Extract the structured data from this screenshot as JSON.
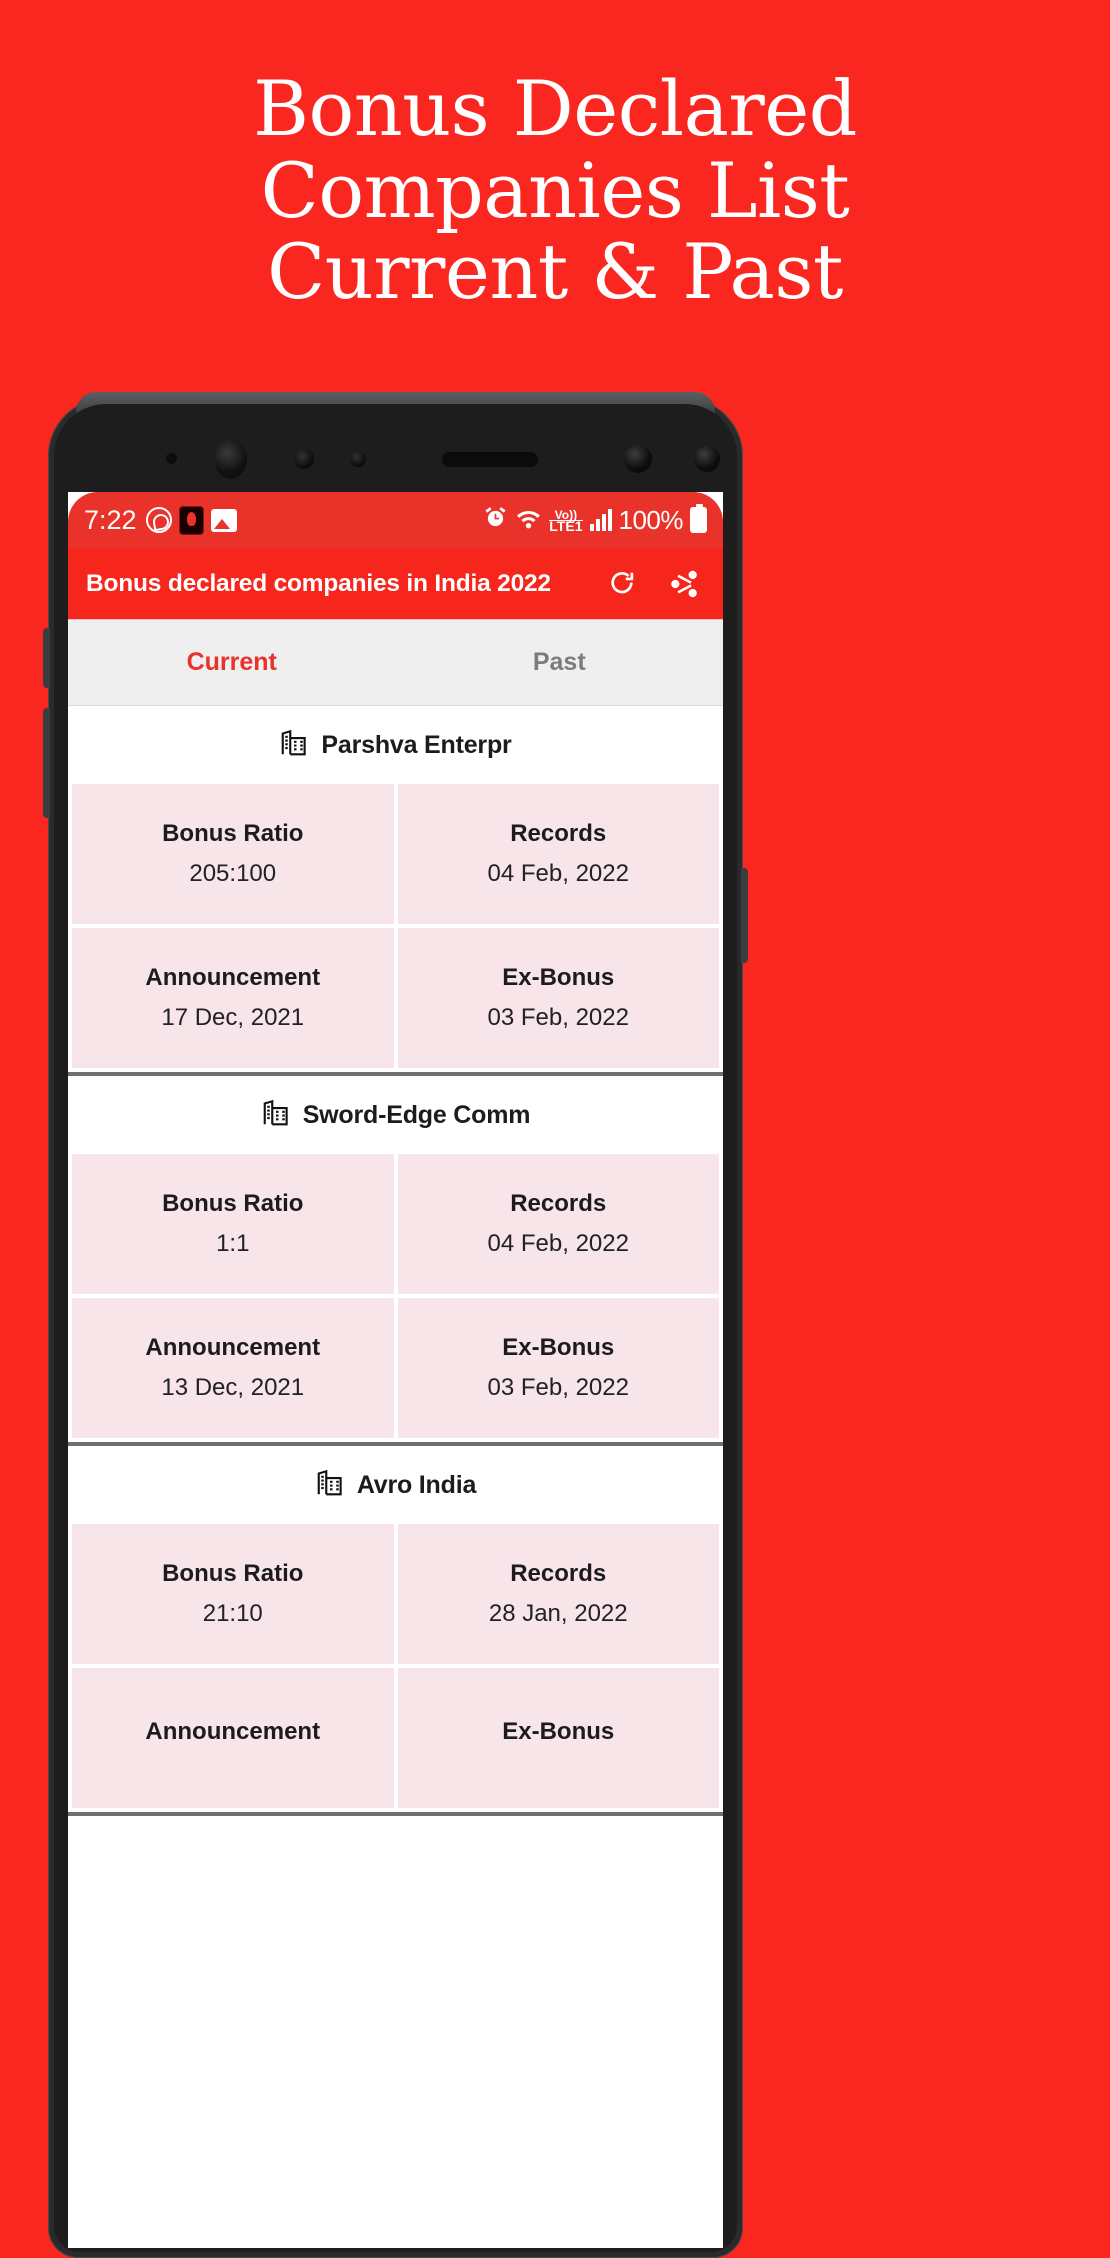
{
  "promo": {
    "headline_lines": [
      "Bonus Declared",
      "Companies List",
      "Current & Past"
    ],
    "background_color": "#fa2720",
    "text_color": "#ffffff"
  },
  "status_bar": {
    "time": "7:22",
    "battery_percent": "100%",
    "network_label_top": "Vo))",
    "network_label_bottom": "LTE1",
    "left_icons": [
      "whatsapp-icon",
      "app-icon",
      "gallery-icon"
    ],
    "right_icons": [
      "alarm-icon",
      "wifi-icon",
      "volte-icon",
      "signal-icon",
      "battery-icon"
    ]
  },
  "app_bar": {
    "title": "Bonus declared companies in India 2022",
    "refresh_label": "refresh-icon",
    "share_label": "share-icon",
    "background_color": "#f6261d"
  },
  "tabs": [
    {
      "label": "Current",
      "active": true
    },
    {
      "label": "Past",
      "active": false
    }
  ],
  "labels": {
    "bonus_ratio": "Bonus Ratio",
    "records": "Records",
    "announcement": "Announcement",
    "ex_bonus": "Ex-Bonus"
  },
  "companies": [
    {
      "name": "Parshva Enterpr",
      "bonus_ratio": "205:100",
      "records": "04 Feb, 2022",
      "announcement": "17 Dec, 2021",
      "ex_bonus": "03 Feb, 2022"
    },
    {
      "name": "Sword-Edge Comm",
      "bonus_ratio": "1:1",
      "records": "04 Feb, 2022",
      "announcement": "13 Dec, 2021",
      "ex_bonus": "03 Feb, 2022"
    },
    {
      "name": "Avro India",
      "bonus_ratio": "21:10",
      "records": "28 Jan, 2022",
      "announcement": "",
      "ex_bonus": ""
    }
  ],
  "colors": {
    "accent": "#e8322a",
    "cell_bg": "#f7e5ea",
    "tab_bg": "#efefef"
  }
}
